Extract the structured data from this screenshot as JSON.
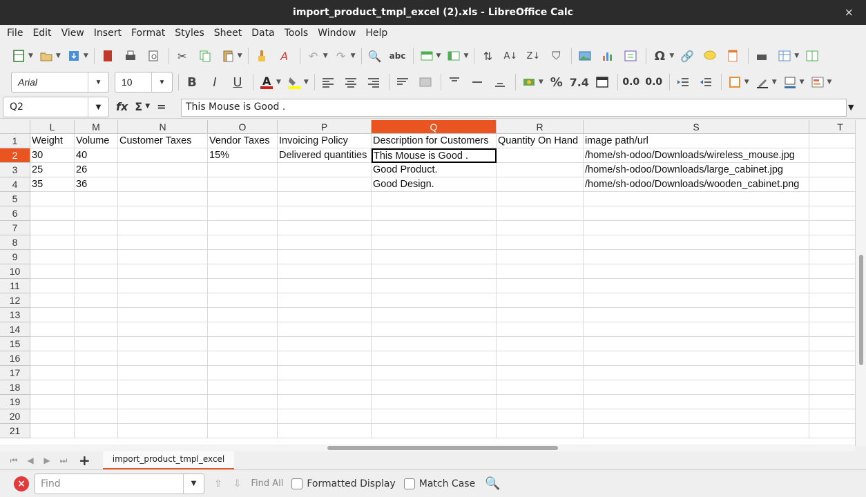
{
  "window": {
    "title": "import_product_tmpl_excel (2).xls - LibreOffice Calc",
    "close_glyph": "×"
  },
  "menu": [
    "File",
    "Edit",
    "View",
    "Insert",
    "Format",
    "Styles",
    "Sheet",
    "Data",
    "Tools",
    "Window",
    "Help"
  ],
  "toolbar2": {
    "font_name": "Arial",
    "font_size": "10",
    "bold": "B",
    "italic": "I",
    "underline": "U",
    "percent": "%",
    "number": "7.4",
    "decimals_add": "0.0",
    "decimals_remove": "0.0"
  },
  "namebox": "Q2",
  "formula_text": "This Mouse is Good .",
  "formula_icons": {
    "fx": "fx",
    "sum": "Σ",
    "equals": "="
  },
  "columns": [
    "L",
    "M",
    "N",
    "O",
    "P",
    "Q",
    "R",
    "S",
    "T"
  ],
  "selected_column": "Q",
  "rows": [
    "1",
    "2",
    "3",
    "4",
    "5",
    "6",
    "7",
    "8",
    "9",
    "10",
    "11",
    "12",
    "13",
    "14",
    "15",
    "16",
    "17",
    "18",
    "19",
    "20",
    "21"
  ],
  "selected_row": "2",
  "cells": {
    "r1": [
      "Weight",
      "Volume",
      "Customer Taxes",
      "Vendor Taxes",
      "Invoicing Policy",
      "Description for Customers",
      "Quantity On Hand",
      "image path/url"
    ],
    "r2": [
      "30",
      "40",
      "",
      "15%",
      "Delivered quantities",
      "This Mouse is Good .",
      "",
      "/home/sh-odoo/Downloads/wireless_mouse.jpg"
    ],
    "r3": [
      "25",
      "26",
      "",
      "",
      "",
      "Good Product.",
      "",
      "/home/sh-odoo/Downloads/large_cabinet.jpg"
    ],
    "r4": [
      "35",
      "36",
      "",
      "",
      "",
      "Good Design.",
      "",
      "/home/sh-odoo/Downloads/wooden_cabinet.png"
    ]
  },
  "sheet_tab": "import_product_tmpl_excel",
  "find": {
    "placeholder": "Find",
    "find_all": "Find All",
    "formatted_display": "Formatted Display",
    "match_case": "Match Case"
  }
}
